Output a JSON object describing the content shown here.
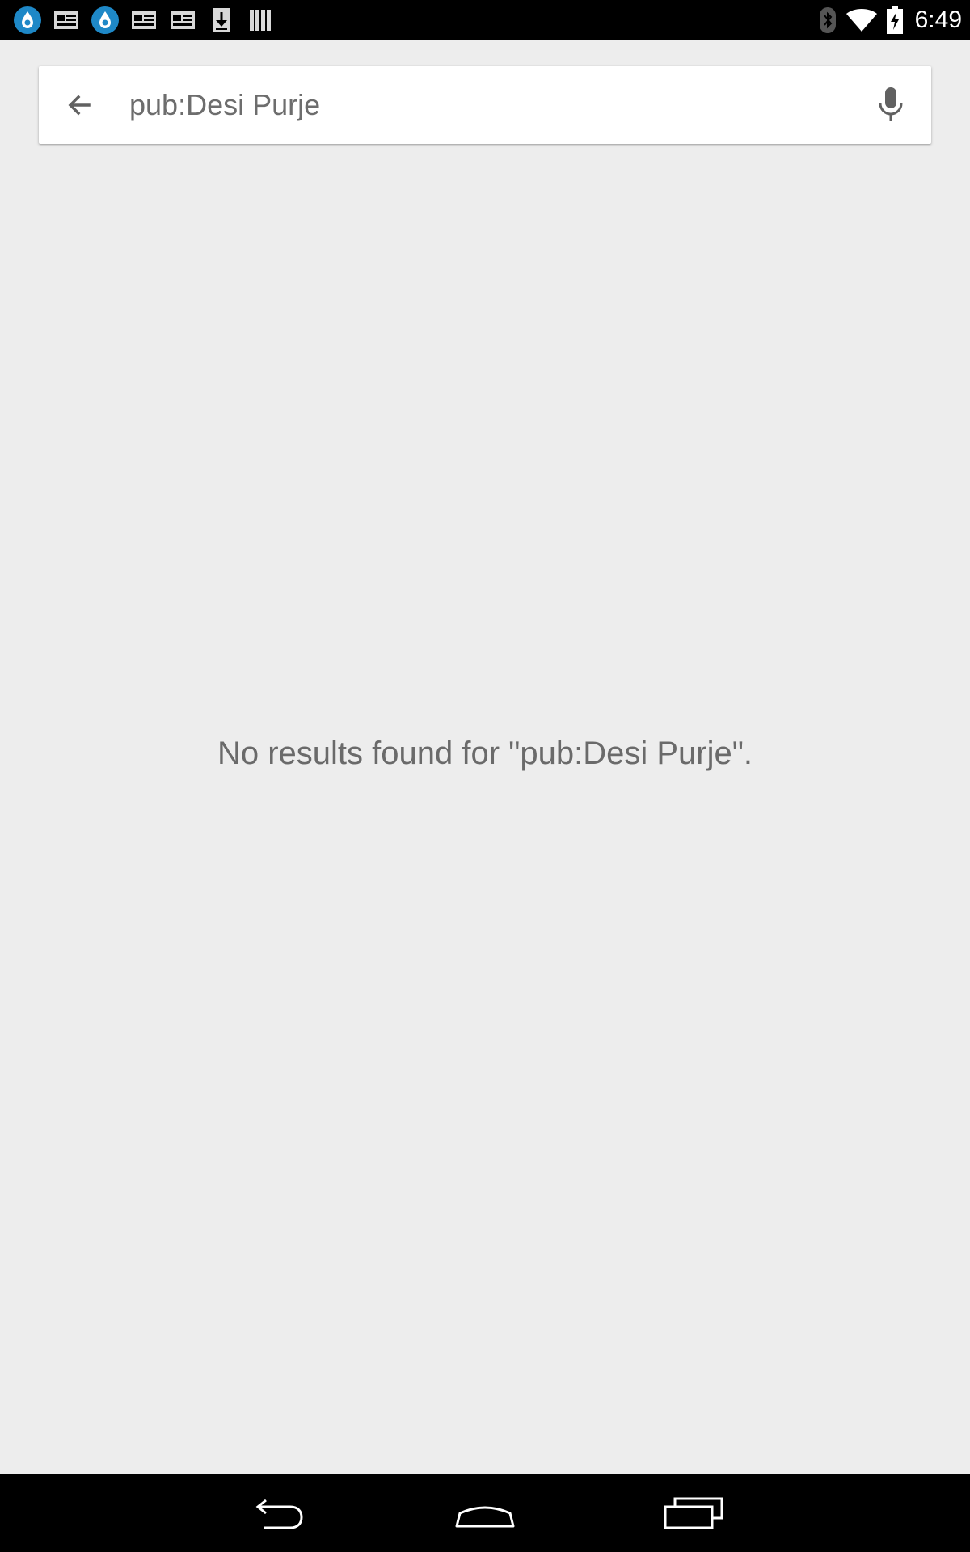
{
  "status_bar": {
    "time": "6:49",
    "notification_icons": [
      "app-drop-icon",
      "news-icon",
      "app-drop-icon",
      "news-icon",
      "news-icon",
      "download-icon",
      "library-icon"
    ],
    "system_icons": [
      "bluetooth-icon",
      "wifi-icon",
      "battery-charging-icon"
    ]
  },
  "search": {
    "query": "pub:Desi Purje"
  },
  "results": {
    "empty_message": "No results found for \"pub:Desi Purje\"."
  },
  "colors": {
    "background": "#ededed",
    "card": "#ffffff",
    "text_secondary": "#6a6a6a",
    "app_drop_blue": "#1e88c7"
  }
}
